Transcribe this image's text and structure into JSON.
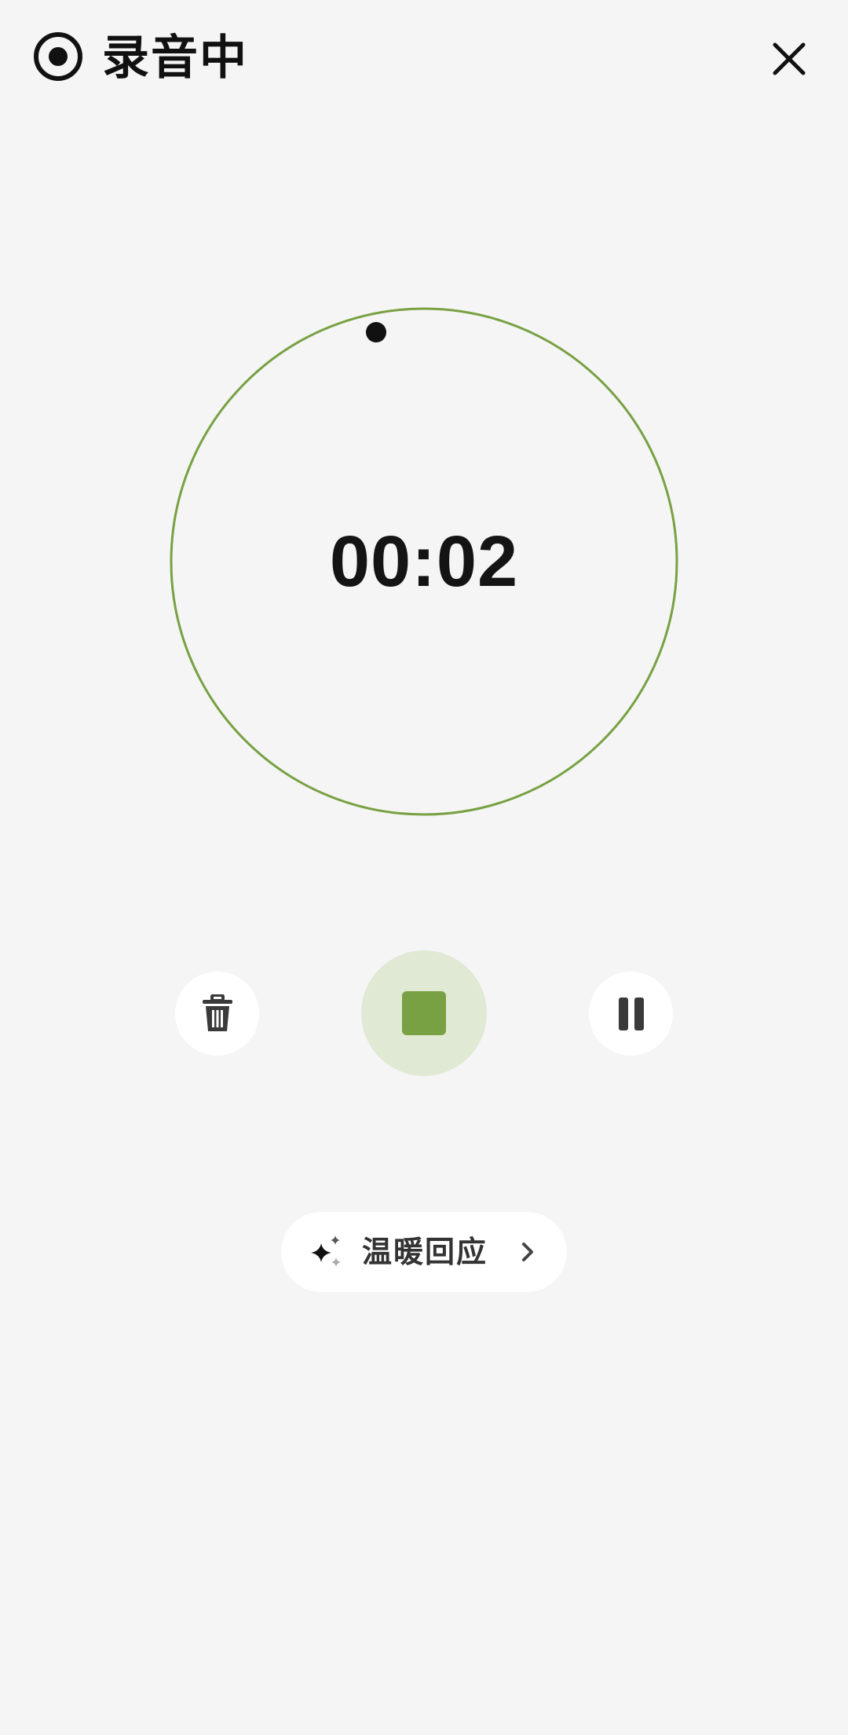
{
  "header": {
    "title": "录音中",
    "record_icon": "record-icon",
    "close_icon": "close-icon"
  },
  "timer": {
    "elapsed": "00:02",
    "ring_color": "#77a142"
  },
  "controls": {
    "delete_icon": "trash-icon",
    "stop_icon": "stop-icon",
    "pause_icon": "pause-icon",
    "stop_bg": "#e0e9d4",
    "stop_fill": "#77a142"
  },
  "warm_response": {
    "label": "温暖回应",
    "sparkle_icon": "sparkle-icon",
    "chevron_icon": "chevron-right-icon"
  }
}
